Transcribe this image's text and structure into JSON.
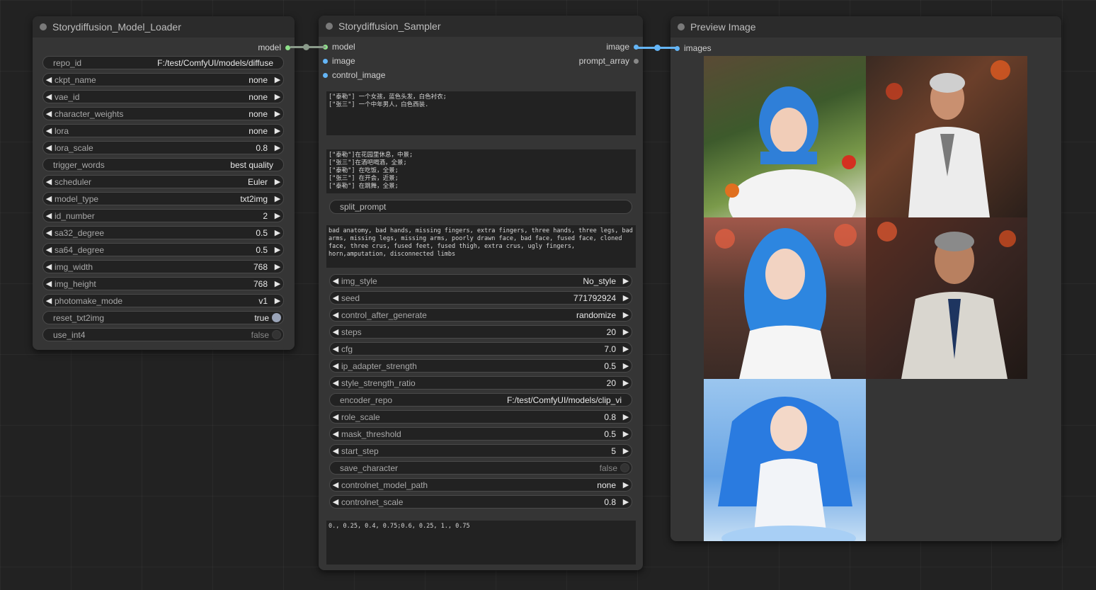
{
  "loader": {
    "title": "Storydiffusion_Model_Loader",
    "output_label": "model",
    "widgets": [
      {
        "label": "repo_id",
        "value": "F:/test/ComfyUI/models/diffuse",
        "kind": "plain"
      },
      {
        "label": "ckpt_name",
        "value": "none",
        "kind": "combo"
      },
      {
        "label": "vae_id",
        "value": "none",
        "kind": "combo"
      },
      {
        "label": "character_weights",
        "value": "none",
        "kind": "combo"
      },
      {
        "label": "lora",
        "value": "none",
        "kind": "combo"
      },
      {
        "label": "lora_scale",
        "value": "0.8",
        "kind": "combo"
      },
      {
        "label": "trigger_words",
        "value": "best quality",
        "kind": "plain"
      },
      {
        "label": "scheduler",
        "value": "Euler",
        "kind": "combo"
      },
      {
        "label": "model_type",
        "value": "txt2img",
        "kind": "combo"
      },
      {
        "label": "id_number",
        "value": "2",
        "kind": "combo"
      },
      {
        "label": "sa32_degree",
        "value": "0.5",
        "kind": "combo"
      },
      {
        "label": "sa64_degree",
        "value": "0.5",
        "kind": "combo"
      },
      {
        "label": "img_width",
        "value": "768",
        "kind": "combo"
      },
      {
        "label": "img_height",
        "value": "768",
        "kind": "combo"
      },
      {
        "label": "photomake_mode",
        "value": "v1",
        "kind": "combo"
      },
      {
        "label": "reset_txt2img",
        "value": "true",
        "kind": "toggle-on"
      },
      {
        "label": "use_int4",
        "value": "false",
        "kind": "toggle-off"
      }
    ]
  },
  "sampler": {
    "title": "Storydiffusion_Sampler",
    "inputs": [
      "model",
      "image",
      "control_image"
    ],
    "outputs": [
      "image",
      "prompt_array"
    ],
    "character_prompt": "[\"泰勒\"] 一个女孩，蓝色头发，白色衬衣;\n[\"张三\"] 一个中年男人，白色西装.",
    "scene_prompt": "[\"泰勒\"]在花园里休息，中景;\n[\"张三\"]在酒吧喝酒，全景;\n[\"泰勒\"] 在吃饭，全景;\n[\"张三\"] 在开会，近景;\n[\"泰勒\"] 在跳舞，全景;",
    "split_button": "split_prompt",
    "negative_prompt": "bad anatomy, bad hands, missing fingers, extra fingers, three hands, three legs, bad arms, missing legs, missing arms, poorly drawn face, bad face, fused face, cloned face, three crus, fused feet, fused thigh, extra crus, ugly fingers, horn,amputation, disconnected limbs",
    "widgets": [
      {
        "label": "img_style",
        "value": "No_style",
        "kind": "combo"
      },
      {
        "label": "seed",
        "value": "771792924",
        "kind": "combo"
      },
      {
        "label": "control_after_generate",
        "value": "randomize",
        "kind": "combo"
      },
      {
        "label": "steps",
        "value": "20",
        "kind": "combo"
      },
      {
        "label": "cfg",
        "value": "7.0",
        "kind": "combo"
      },
      {
        "label": "ip_adapter_strength",
        "value": "0.5",
        "kind": "combo"
      },
      {
        "label": "style_strength_ratio",
        "value": "20",
        "kind": "combo"
      },
      {
        "label": "encoder_repo",
        "value": "F:/test/ComfyUI/models/clip_vi",
        "kind": "plain"
      },
      {
        "label": "role_scale",
        "value": "0.8",
        "kind": "combo"
      },
      {
        "label": "mask_threshold",
        "value": "0.5",
        "kind": "combo"
      },
      {
        "label": "start_step",
        "value": "5",
        "kind": "combo"
      },
      {
        "label": "save_character",
        "value": "false",
        "kind": "toggle-off"
      },
      {
        "label": "controlnet_model_path",
        "value": "none",
        "kind": "combo"
      },
      {
        "label": "controlnet_scale",
        "value": "0.8",
        "kind": "combo"
      }
    ],
    "mask_text": "0., 0.25, 0.4, 0.75;0.6, 0.25, 1., 0.75"
  },
  "preview": {
    "title": "Preview Image",
    "input_label": "images"
  },
  "colors": {
    "model_slot": "#8ee08a",
    "image_slot": "#64b5f6"
  }
}
